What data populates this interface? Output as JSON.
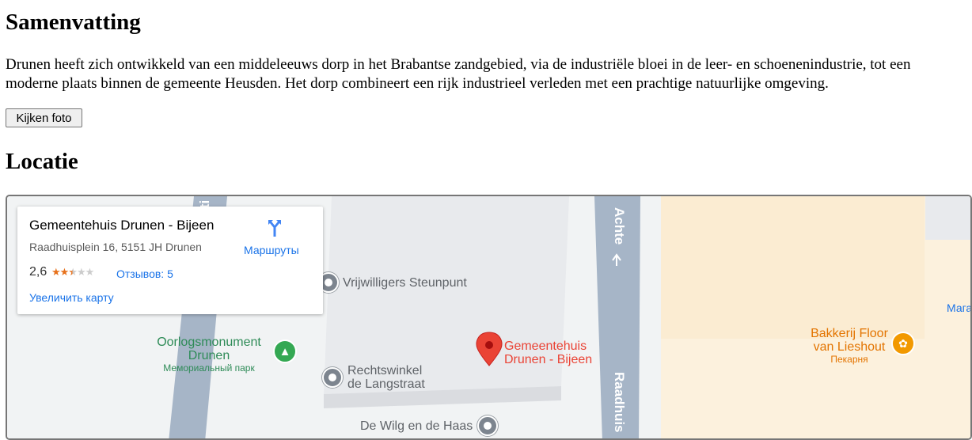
{
  "summary": {
    "heading": "Samenvatting",
    "text": "Drunen heeft zich ontwikkeld van een middeleeuws dorp in het Brabantse zandgebied, via de industriële bloei in de leer- en schoenenindustrie, tot een moderne plaats binnen de gemeente Heusden. Het dorp combineert een rijk industrieel verleden met een prachtige natuurlijke omgeving.",
    "button_label": "Kijken foto"
  },
  "location": {
    "heading": "Locatie"
  },
  "map": {
    "card": {
      "title": "Gemeentehuis Drunen - Bijeen",
      "address": "Raadhuisplein 16, 5151 JH Drunen",
      "rating": "2,6",
      "stars": {
        "filled": 2,
        "half": 1,
        "empty": 2
      },
      "reviews": "Отзывов: 5",
      "enlarge": "Увеличить карту",
      "directions": "Маршруты"
    },
    "streets": {
      "achter": "Achte",
      "raadhuis": "Raadhuis",
      "top_left": "ti"
    },
    "pois": {
      "vrijwilligers": "Vrijwilligers Steunpunt",
      "rechtswinkel_1": "Rechtswinkel",
      "rechtswinkel_2": "de Langstraat",
      "wilg": "De Wilg en de Haas",
      "monument_1": "Oorlogsmonument",
      "monument_2": "Drunen",
      "monument_sub": "Мемориальный парк",
      "bakery_1": "Bakkerij Floor",
      "bakery_2": "van Lieshout",
      "bakery_sub": "Пекарня",
      "pin_1": "Gemeentehuis",
      "pin_2": "Drunen - Bijeen",
      "edge_label": "Мага"
    },
    "colors": {
      "road": "#a6b5c7",
      "building": "#e8eaed",
      "commercial": "#fcf1dd",
      "pin": "#ea4335",
      "park": "#34a853",
      "food": "#f29900",
      "link": "#1a73e8"
    }
  }
}
